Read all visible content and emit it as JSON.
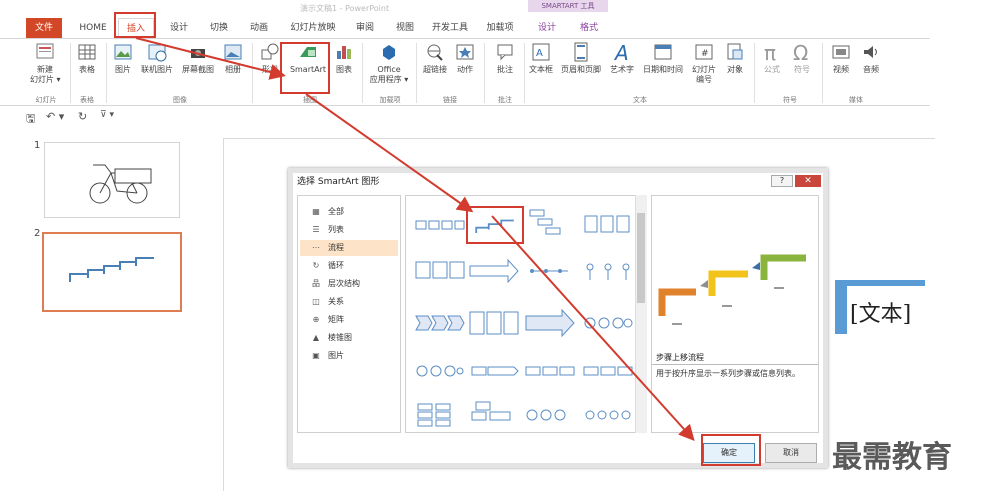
{
  "window": {
    "title": "演示文稿1 - PowerPoint",
    "contextual_group": "SMARTART 工具"
  },
  "tabs": [
    "文件",
    "HOME",
    "插入",
    "设计",
    "切换",
    "动画",
    "幻灯片放映",
    "审阅",
    "视图",
    "开发工具",
    "加载项",
    "设计",
    "格式"
  ],
  "ribbon": {
    "buttons": [
      {
        "label": "新建\n幻灯片 ▾",
        "icon": "new-slide-icon"
      },
      {
        "label": "表格",
        "icon": "table-icon"
      },
      {
        "label": "图片",
        "icon": "picture-icon"
      },
      {
        "label": "联机图片",
        "icon": "online-picture-icon"
      },
      {
        "label": "屏幕截图",
        "icon": "screenshot-icon"
      },
      {
        "label": "相册",
        "icon": "album-icon"
      },
      {
        "label": "形状",
        "icon": "shapes-icon"
      },
      {
        "label": "SmartArt",
        "icon": "smartart-icon"
      },
      {
        "label": "图表",
        "icon": "chart-icon"
      },
      {
        "label": "Office\n应用程序 ▾",
        "icon": "office-apps-icon"
      },
      {
        "label": "超链接",
        "icon": "hyperlink-icon"
      },
      {
        "label": "动作",
        "icon": "action-icon"
      },
      {
        "label": "批注",
        "icon": "comment-icon"
      },
      {
        "label": "文本框",
        "icon": "textbox-icon"
      },
      {
        "label": "页眉和页脚",
        "icon": "header-footer-icon"
      },
      {
        "label": "艺术字",
        "icon": "wordart-icon"
      },
      {
        "label": "日期和时间",
        "icon": "datetime-icon"
      },
      {
        "label": "幻灯片\n编号",
        "icon": "slide-number-icon"
      },
      {
        "label": "对象",
        "icon": "object-icon"
      },
      {
        "label": "公式",
        "icon": "equation-icon"
      },
      {
        "label": "符号",
        "icon": "symbol-icon"
      },
      {
        "label": "视频",
        "icon": "video-icon"
      },
      {
        "label": "音频",
        "icon": "audio-icon"
      }
    ],
    "groups": [
      "幻灯片",
      "表格",
      "图像",
      "插图",
      "加载项",
      "链接",
      "批注",
      "文本",
      "符号",
      "媒体"
    ]
  },
  "qat": {
    "save": "🖫",
    "undo": "↶ ▾",
    "redo": "↻",
    "customize": "⊽ ▾"
  },
  "thumbnails": [
    {
      "num": "1"
    },
    {
      "num": "2"
    }
  ],
  "slide": {
    "placeholder": "[文本]"
  },
  "dialog": {
    "title": "选择 SmartArt 图形",
    "help": "?",
    "close": "✕",
    "categories": [
      {
        "icon": "▦",
        "label": "全部"
      },
      {
        "icon": "☰",
        "label": "列表"
      },
      {
        "icon": "⋯",
        "label": "流程",
        "selected": true
      },
      {
        "icon": "↻",
        "label": "循环"
      },
      {
        "icon": "品",
        "label": "层次结构"
      },
      {
        "icon": "◫",
        "label": "关系"
      },
      {
        "icon": "⊕",
        "label": "矩阵"
      },
      {
        "icon": "▲",
        "label": "棱锥图"
      },
      {
        "icon": "▣",
        "label": "图片"
      }
    ],
    "preview_title": "步骤上移流程",
    "preview_desc": "用于按升序显示一系列步骤或信息列表。",
    "ok": "确定",
    "cancel": "取消"
  },
  "watermark": "最需教育",
  "colors": {
    "accent": "#d24726",
    "annotation": "#d23b2e",
    "textbox_border": "#5b9bd5"
  }
}
